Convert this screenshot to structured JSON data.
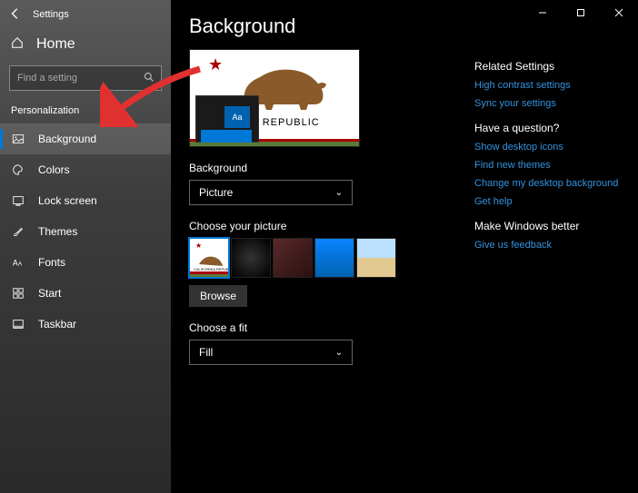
{
  "window": {
    "title": "Settings"
  },
  "sidebar": {
    "home_label": "Home",
    "search_placeholder": "Find a setting",
    "group_label": "Personalization",
    "items": [
      {
        "label": "Background",
        "icon": "picture-icon",
        "selected": true
      },
      {
        "label": "Colors",
        "icon": "palette-icon",
        "selected": false
      },
      {
        "label": "Lock screen",
        "icon": "lock-frame-icon",
        "selected": false
      },
      {
        "label": "Themes",
        "icon": "brush-icon",
        "selected": false
      },
      {
        "label": "Fonts",
        "icon": "fonts-icon",
        "selected": false
      },
      {
        "label": "Start",
        "icon": "start-tiles-icon",
        "selected": false
      },
      {
        "label": "Taskbar",
        "icon": "taskbar-icon",
        "selected": false
      }
    ]
  },
  "page": {
    "title": "Background",
    "preview": {
      "sample_text": "Aa",
      "flag_text": "RNIA REPUBLIC"
    },
    "background_label": "Background",
    "background_value": "Picture",
    "choose_picture_label": "Choose your picture",
    "thumbnails": [
      {
        "name": "california-flag",
        "selected": true
      },
      {
        "name": "dark-abstract",
        "selected": false
      },
      {
        "name": "person-red",
        "selected": false
      },
      {
        "name": "blue-default",
        "selected": false
      },
      {
        "name": "landscape",
        "selected": false
      }
    ],
    "browse_label": "Browse",
    "fit_label": "Choose a fit",
    "fit_value": "Fill"
  },
  "right": {
    "related_heading": "Related Settings",
    "related_links": [
      "High contrast settings",
      "Sync your settings"
    ],
    "question_heading": "Have a question?",
    "question_links": [
      "Show desktop icons",
      "Find new themes",
      "Change my desktop background",
      "Get help"
    ],
    "better_heading": "Make Windows better",
    "better_links": [
      "Give us feedback"
    ]
  }
}
